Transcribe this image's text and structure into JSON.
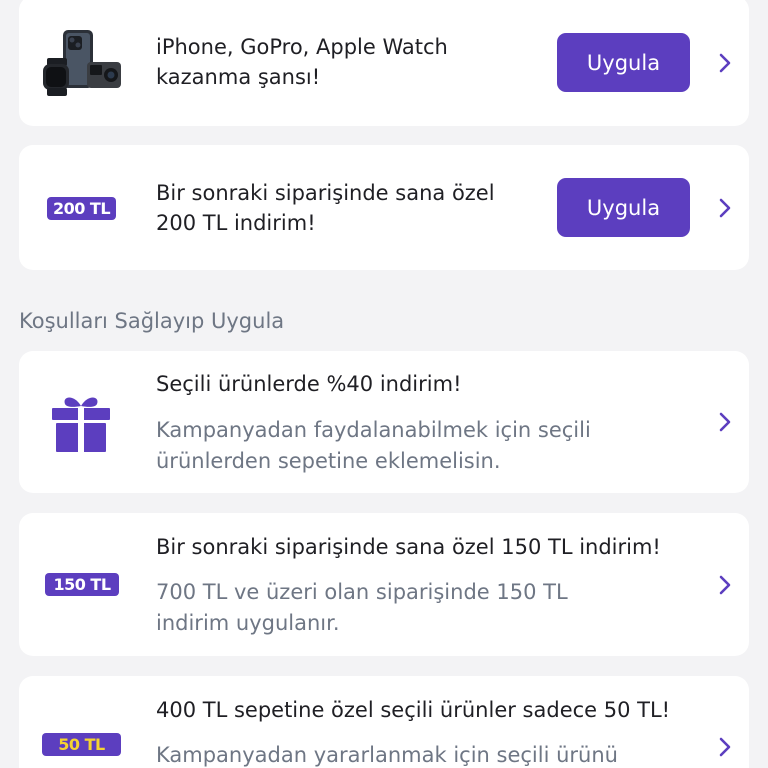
{
  "cards": [
    {
      "title_line1": "iPhone, GoPro, Apple Watch",
      "title_line2": "kazanma şansı!",
      "button": "Uygula",
      "icon": "devices-prize-image"
    },
    {
      "badge": "200 TL",
      "title_line1": "Bir sonraki siparişinde sana özel",
      "title_line2": "200 TL indirim!",
      "button": "Uygula"
    }
  ],
  "section": {
    "title": "Koşulları Sağlayıp Uygula"
  },
  "conditions": [
    {
      "icon": "gift-icon",
      "title": "Seçili ürünlerde %40 indirim!",
      "desc_line1": "Kampanyadan faydalanabilmek için seçili",
      "desc_line2": "ürünlerden sepetine eklemelisin."
    },
    {
      "badge": "150 TL",
      "title": "Bir sonraki siparişinde sana özel 150 TL indirim!",
      "desc_line1": "700 TL ve üzeri olan siparişinde 150 TL",
      "desc_line2": "indirim uygulanır."
    },
    {
      "badge": "50 TL",
      "badge_text_color": "#f5d431",
      "title": "400 TL sepetine özel seçili ürünler sadece 50 TL!",
      "desc_line1": "Kampanyadan yararlanmak için seçili ürünü"
    }
  ],
  "colors": {
    "accent": "#5c3ebf",
    "background": "#f3f3f5",
    "text": "#1f1f24",
    "muted": "#6e7684"
  }
}
